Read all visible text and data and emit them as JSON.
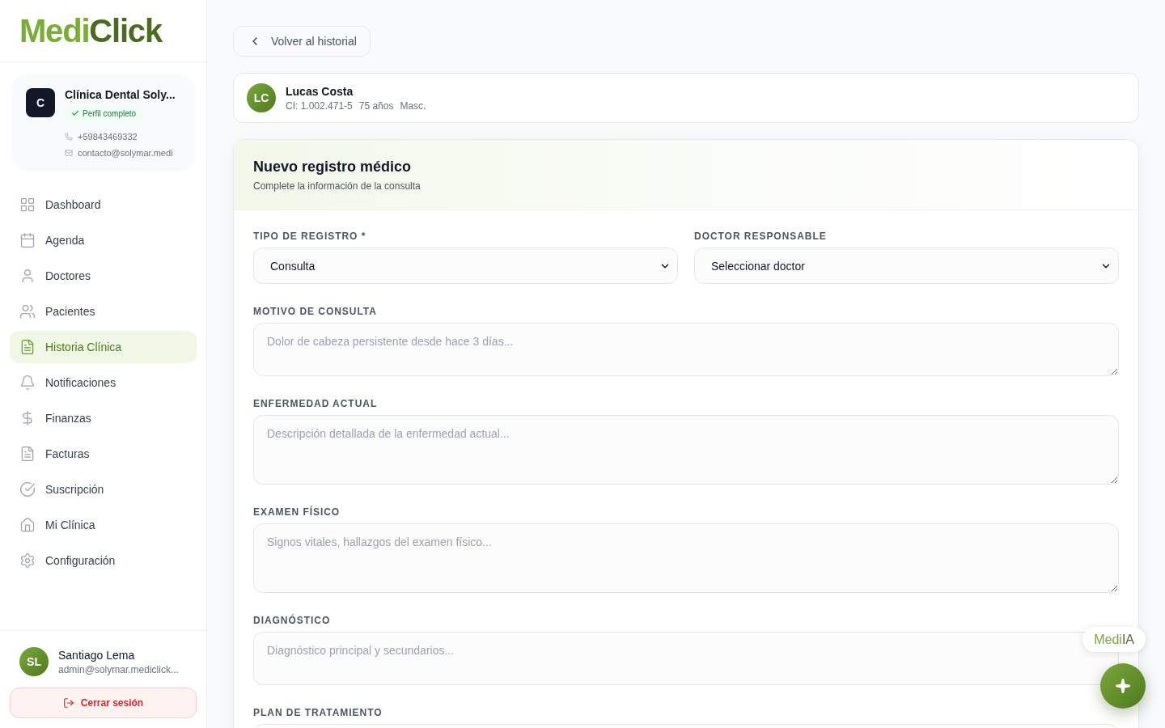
{
  "sidebar": {
    "logo": {
      "part_1": "Medi",
      "part_2": "Click"
    },
    "clinic": {
      "initial": "C",
      "name": "Clínica Dental Soly...",
      "badge": "Perfil completo",
      "phone": "+59843469332",
      "email": "contacto@solymar.medi"
    },
    "nav": [
      {
        "label": "Dashboard",
        "selected": false
      },
      {
        "label": "Agenda",
        "selected": false
      },
      {
        "label": "Doctores",
        "selected": false
      },
      {
        "label": "Pacientes",
        "selected": false
      },
      {
        "label": "Historia Clínica",
        "selected": true
      },
      {
        "label": "Notificaciones",
        "selected": false
      },
      {
        "label": "Finanzas",
        "selected": false
      },
      {
        "label": "Facturas",
        "selected": false
      },
      {
        "label": "Suscripción",
        "selected": false
      },
      {
        "label": "Mi Clínica",
        "selected": false
      },
      {
        "label": "Configuración",
        "selected": false
      }
    ],
    "user": {
      "initials": "SL",
      "name": "Santiago Lema",
      "email": "admin@solymar.mediclick..."
    },
    "logout_button": "Cerrar sesión"
  },
  "main": {
    "back_button": "Volver al historial",
    "patient": {
      "initials": "LC",
      "name": "Lucas Costa",
      "id_number": "CI: 1.002.471-5",
      "age": "75 años",
      "sex": "Masc."
    },
    "form": {
      "title": "Nuevo registro médico",
      "subtitle": "Complete la información de la consulta",
      "selects": [
        {
          "label": "TIPO DE REGISTRO *",
          "value": "Consulta"
        },
        {
          "label": "DOCTOR RESPONSABLE",
          "value": "Seleccionar doctor"
        }
      ],
      "textareas": [
        {
          "label": "MOTIVO DE CONSULTA",
          "placeholder": "Dolor de cabeza persistente desde hace 3 días..."
        },
        {
          "label": "ENFERMEDAD ACTUAL",
          "placeholder": "Descripción detallada de la enfermedad actual..."
        },
        {
          "label": "EXAMEN FÍSICO",
          "placeholder": "Signos vitales, hallazgos del examen físico..."
        },
        {
          "label": "DIAGNÓSTICO",
          "placeholder": "Diagnóstico principal y secundarios..."
        },
        {
          "label": "PLAN DE TRATAMIENTO"
        }
      ]
    }
  },
  "assistant": {
    "label_part_1": "Medi",
    "label_part_2": "IA"
  }
}
